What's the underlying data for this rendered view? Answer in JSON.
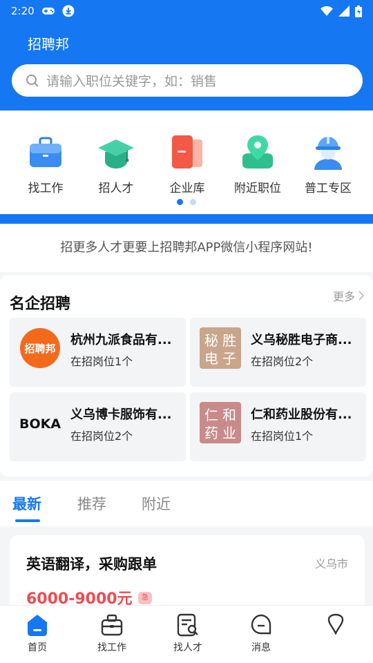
{
  "status_bar": {
    "time": "2:20",
    "icons": [
      "gamepad-icon",
      "download-icon",
      "wifi-icon",
      "signal-icon",
      "battery-icon"
    ]
  },
  "app": {
    "title": "招聘邦",
    "brand_color": "#1677f2"
  },
  "search": {
    "placeholder": "请输入职位关键字，如：销售"
  },
  "quick_nav": {
    "items": [
      {
        "label": "找工作",
        "icon": "briefcase-icon"
      },
      {
        "label": "招人才",
        "icon": "graduation-cap-icon"
      },
      {
        "label": "企业库",
        "icon": "company-book-icon"
      },
      {
        "label": "附近职位",
        "icon": "location-pin-icon"
      },
      {
        "label": "普工专区",
        "icon": "worker-helmet-icon"
      }
    ],
    "page_count": 2,
    "current_page": 1
  },
  "promo": {
    "text": "招更多人才更要上招聘邦APP微信小程序网站!"
  },
  "famous": {
    "title": "名企招聘",
    "more": "更多",
    "companies": [
      {
        "name": "杭州九派食品有...",
        "count": "在招岗位1个",
        "logo_text": "招聘邦"
      },
      {
        "name": "义乌秘胜电子商...",
        "count": "在招岗位2个",
        "logo_text": "秘胜电子"
      },
      {
        "name": "义乌博卡服饰有...",
        "count": "在招岗位2个",
        "logo_text": "BOKA"
      },
      {
        "name": "仁和药业股份有...",
        "count": "在招岗位1个",
        "logo_text": "仁和药业"
      }
    ]
  },
  "tabs": {
    "items": [
      "最新",
      "推荐",
      "附近"
    ],
    "active": 0
  },
  "job": {
    "title": "英语翻译，采购跟单",
    "location": "义乌市",
    "salary": "6000-9000元",
    "urgent": "急"
  },
  "bottom_nav": {
    "items": [
      "首页",
      "找工作",
      "找人才",
      "消息",
      ""
    ]
  }
}
